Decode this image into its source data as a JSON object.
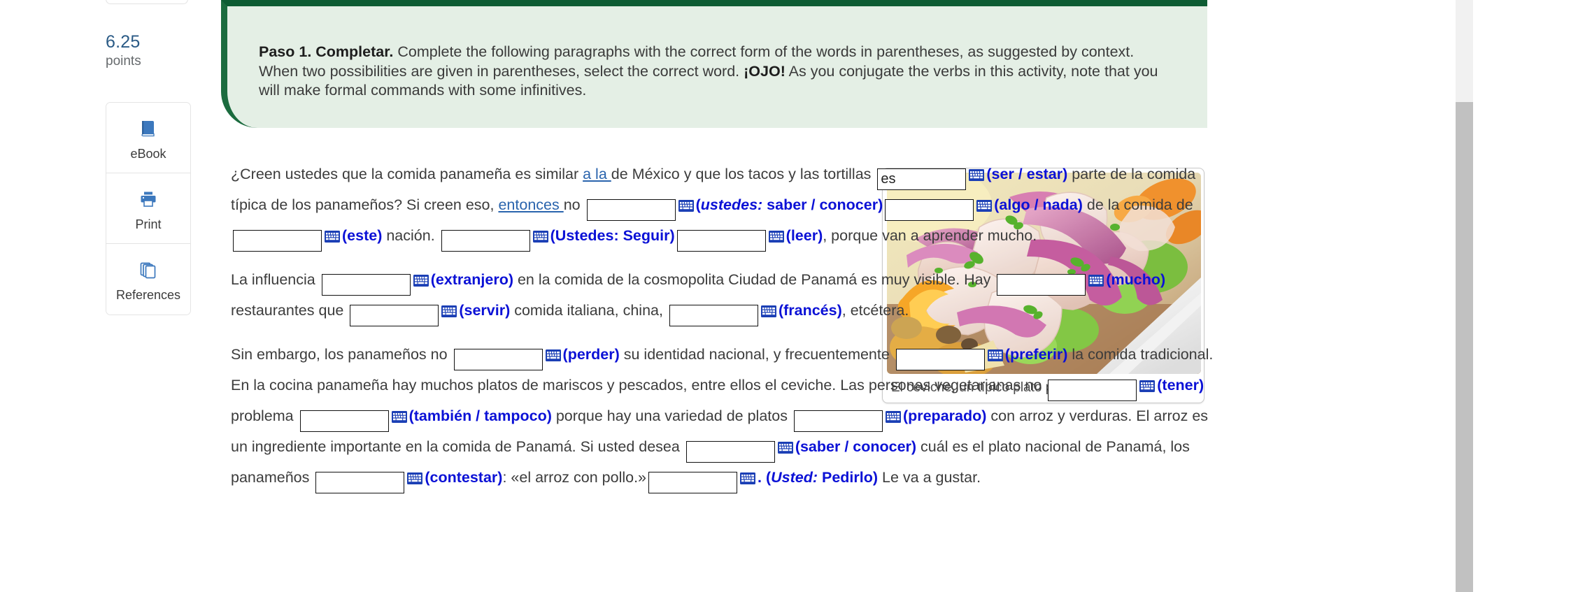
{
  "sidebar": {
    "points_value": "6.25",
    "points_label": "points",
    "tools": [
      {
        "label": "eBook",
        "icon": "book-icon"
      },
      {
        "label": "Print",
        "icon": "printer-icon"
      },
      {
        "label": "References",
        "icon": "copy-pages-icon"
      }
    ]
  },
  "callout": {
    "step_title": "Paso 1. Completar.",
    "text_1": " Complete the following paragraphs with the correct form of the words in parentheses, as suggested by context. When two possibilities are given in parentheses, select the correct word. ",
    "emphasis": "¡OJO!",
    "text_2": " As you conjugate the verbs in this activity, note that you will make formal commands with some infinitives."
  },
  "exercise": {
    "p1": {
      "t1": "¿Creen ustedes que la comida panameña es similar ",
      "link1": "a la ",
      "t2": " de México y que los tacos y las tortillas ",
      "input1_value": "es",
      "cue1": "(ser / estar)",
      "t3": " parte de la comida típica de los panameños? Si creen eso, ",
      "link2": "entonces ",
      "t4": " no ",
      "cue2_pre": "(",
      "cue2_em": "ustedes:",
      "cue2_post": " saber / conocer)",
      "cue3": "(algo / nada)",
      "t5": " de la comida de ",
      "cue4": "(este)",
      "t6": " nación. ",
      "cue5": "(Ustedes: Seguir)",
      "cue6": "(leer)",
      "t7": ", porque van a aprender mucho."
    },
    "p2": {
      "t1": "La influencia ",
      "cue1": "(extranjero)",
      "t2": " en la comida de la cosmopolita Ciudad de Panamá es muy visible. Hay ",
      "cue2": "(mucho)",
      "t3": " restaurantes que ",
      "cue3": "(servir)",
      "t4": " comida italiana, china, ",
      "cue4": "(francés)",
      "t5": ", etcétera."
    },
    "p3": {
      "t1": "Sin embargo, los panameños no ",
      "cue1": "(perder)",
      "t2": " su identidad nacional, y frecuentemente ",
      "cue2": "(preferir)",
      "t3": " la comida tradicional. En la cocina panameña hay muchos platos de mariscos y pescados, entre ellos el ceviche. Las personas vegetarianas no ",
      "cue3": "(tener)",
      "t4": " problema ",
      "cue4": "(también / tampoco)",
      "t5": " porque hay una variedad de platos ",
      "cue5": "(preparado)",
      "t6": " con arroz y verduras. El arroz es un ingrediente importante en la comida de Panamá. Si usted desea ",
      "cue6": "(saber / conocer)",
      "t7": " cuál es el plato nacional de Panamá, los panameños ",
      "cue7": "(contestar)",
      "t8": ": «el arroz con pollo.»",
      "cue8_pre": ". (",
      "cue8_em": "Usted:",
      "cue8_post": " Pedirlo)",
      "t9": " Le va a gustar."
    }
  },
  "figure": {
    "caption": "El ceviche, un típico plato panameño",
    "alt": "ceviche-photo"
  },
  "colors": {
    "callout_bg": "#e4efe5",
    "callout_border": "#1b6b3e",
    "cue_blue": "#0b11d6",
    "link_blue": "#2a64ad",
    "points_blue": "#2b5b86",
    "tool_icon_blue": "#3c78bd"
  }
}
